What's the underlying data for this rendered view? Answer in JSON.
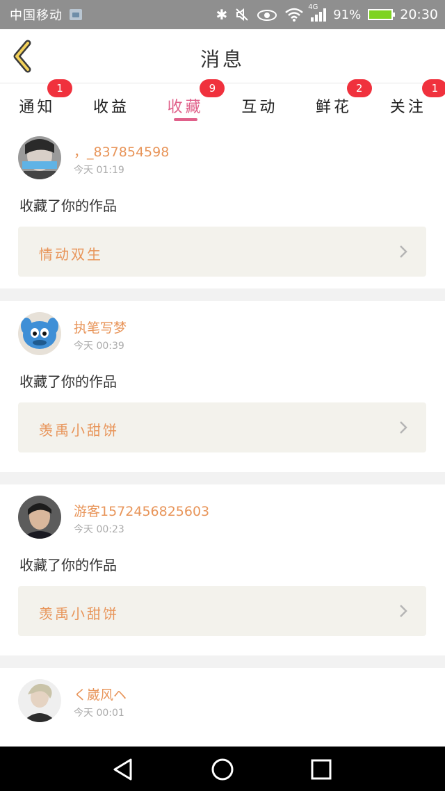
{
  "status_bar": {
    "carrier": "中国移动",
    "network": "4G",
    "battery": "91%",
    "time": "20:30"
  },
  "header": {
    "title": "消息"
  },
  "tabs": [
    {
      "label": "通知",
      "badge": "1",
      "active": false
    },
    {
      "label": "收益",
      "badge": "",
      "active": false
    },
    {
      "label": "收藏",
      "badge": "9",
      "active": true
    },
    {
      "label": "互动",
      "badge": "",
      "active": false
    },
    {
      "label": "鲜花",
      "badge": "2",
      "active": false
    },
    {
      "label": "关注",
      "badge": "1",
      "active": false
    }
  ],
  "messages": [
    {
      "username": "，_837854598",
      "time": "今天 01:19",
      "action": "收藏了你的作品",
      "work": "情动双生"
    },
    {
      "username": "执笔写梦",
      "time": "今天 00:39",
      "action": "收藏了你的作品",
      "work": "羡禹小甜饼"
    },
    {
      "username": "游客1572456825603",
      "time": "今天 00:23",
      "action": "收藏了你的作品",
      "work": "羡禹小甜饼"
    },
    {
      "username": "く崴风ヘ",
      "time": "今天 00:01"
    }
  ],
  "colors": {
    "accent_pink": "#e0608a",
    "username_orange": "#e8955a",
    "badge_red": "#f0313d",
    "status_bar_gray": "#8f8f8f"
  }
}
